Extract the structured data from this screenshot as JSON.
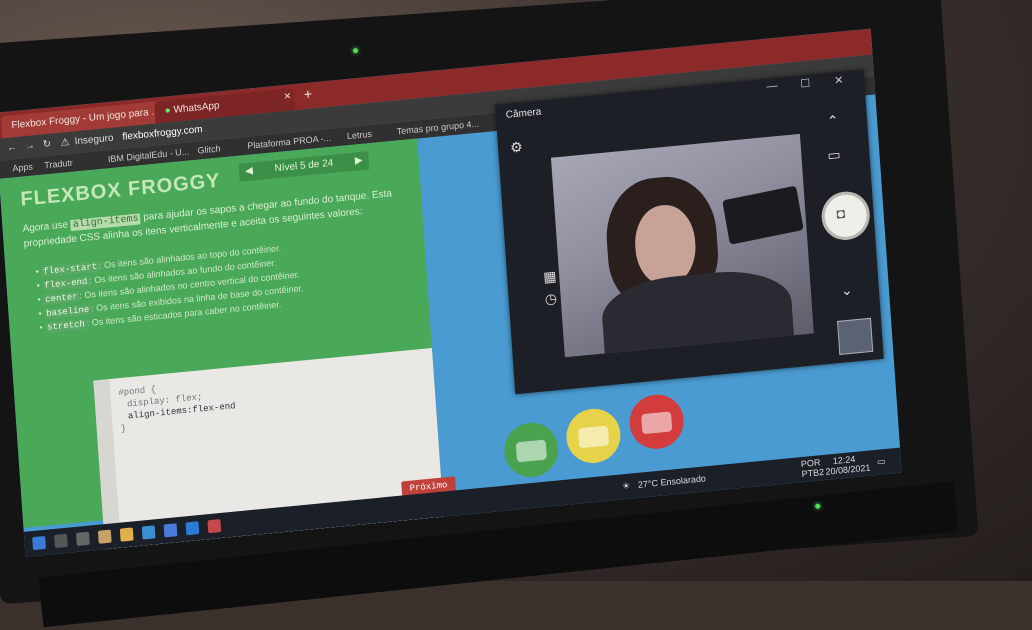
{
  "browser": {
    "tabs": [
      {
        "label": "Flexbox Froggy - Um jogo para ..."
      },
      {
        "label": "WhatsApp"
      }
    ],
    "address": {
      "security_label": "Inseguro",
      "url": "flexboxfroggy.com"
    },
    "bookmarks": [
      {
        "label": "Apps"
      },
      {
        "label": "Tradutr"
      },
      {
        "label": "IBM DigitalEdu - U..."
      },
      {
        "label": "Glitch"
      },
      {
        "label": "Plataforma PROA -..."
      },
      {
        "label": "Letrus"
      },
      {
        "label": "Temas pro grupo 4..."
      }
    ]
  },
  "game": {
    "logo": "FLEXBOX FROGGY",
    "level": "Nível 5 de 24",
    "intro_prefix": "Agora use ",
    "intro_code": "align-items",
    "intro_suffix": " para ajudar os sapos a chegar ao fundo do tanque. Esta propriedade CSS alinha os itens verticalmente e aceita os seguintes valores:",
    "values": [
      {
        "code": "flex-start",
        "desc": ": Os itens são alinhados ao topo do contêiner."
      },
      {
        "code": "flex-end",
        "desc": ": Os itens são alinhados ao fundo do contêiner."
      },
      {
        "code": "center",
        "desc": ": Os itens são alinhados no centro vertical do contêiner."
      },
      {
        "code": "baseline",
        "desc": ": Os itens são exibidos na linha de base do contêiner."
      },
      {
        "code": "stretch",
        "desc": ": Os itens são esticados para caber no contêiner."
      }
    ],
    "code_lines": [
      "#pond {",
      "display: flex;",
      "align-items:flex-end",
      "}"
    ],
    "next_button": "Próximo"
  },
  "camera": {
    "title": "Câmera"
  },
  "taskbar": {
    "weather": "27°C  Ensolarado",
    "lang": "POR",
    "lang2": "PTB2",
    "time": "12:24",
    "date": "20/08/2021"
  }
}
